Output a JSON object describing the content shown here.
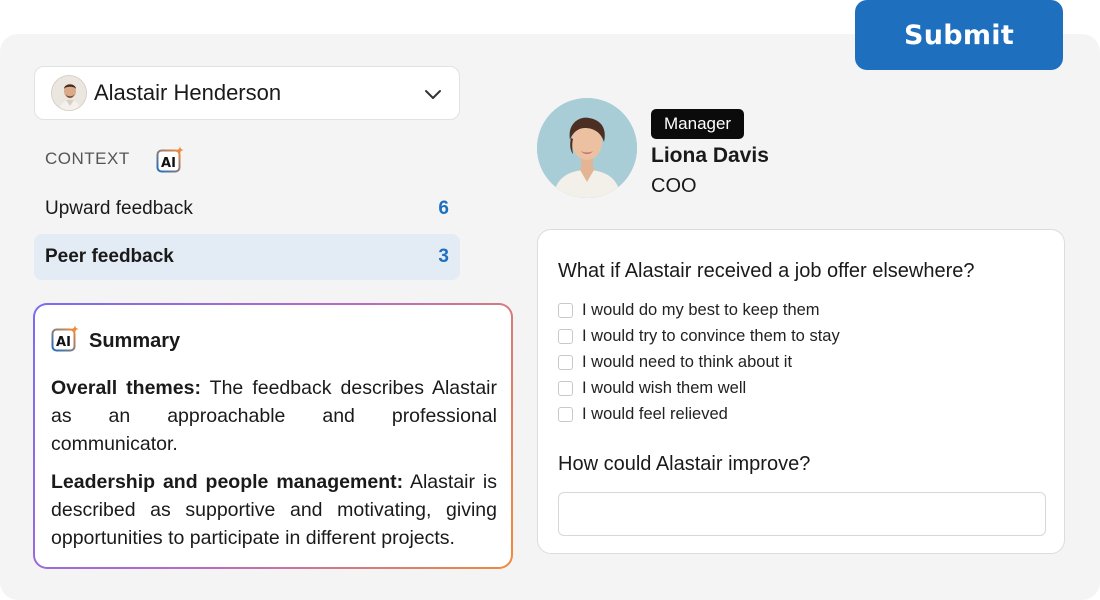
{
  "submit_label": "Submit",
  "selector": {
    "name": "Alastair Henderson"
  },
  "context": {
    "label": "CONTEXT",
    "ai_label": "AI"
  },
  "feedback": [
    {
      "label": "Upward feedback",
      "count": "6"
    },
    {
      "label": "Peer feedback",
      "count": "3"
    }
  ],
  "summary": {
    "title": "Summary",
    "ai_label": "AI",
    "sections": [
      {
        "heading": "Overall themes:",
        "text": "The feedback describes Alastair as an approachable and professional communicator."
      },
      {
        "heading": "Leadership and people management:",
        "text": "Alastair is described as supportive and motivating, giving opportunities to participate in different projects."
      }
    ]
  },
  "profile": {
    "badge": "Manager",
    "name": "Liona Davis",
    "title": "COO"
  },
  "questions": {
    "q1": "What if Alastair received a job offer elsewhere?",
    "options": [
      "I would do my best to keep them",
      "I would try to convince them to stay",
      "I would need to think about it",
      "I would wish them well",
      "I would feel relieved"
    ],
    "q2": "How could Alastair improve?",
    "q2_value": ""
  },
  "colors": {
    "accent": "#1f6fbf",
    "peer_highlight": "#e3ebf4",
    "ai_gradient_start": "#7b6cf0",
    "ai_gradient_end": "#f08a3c"
  }
}
